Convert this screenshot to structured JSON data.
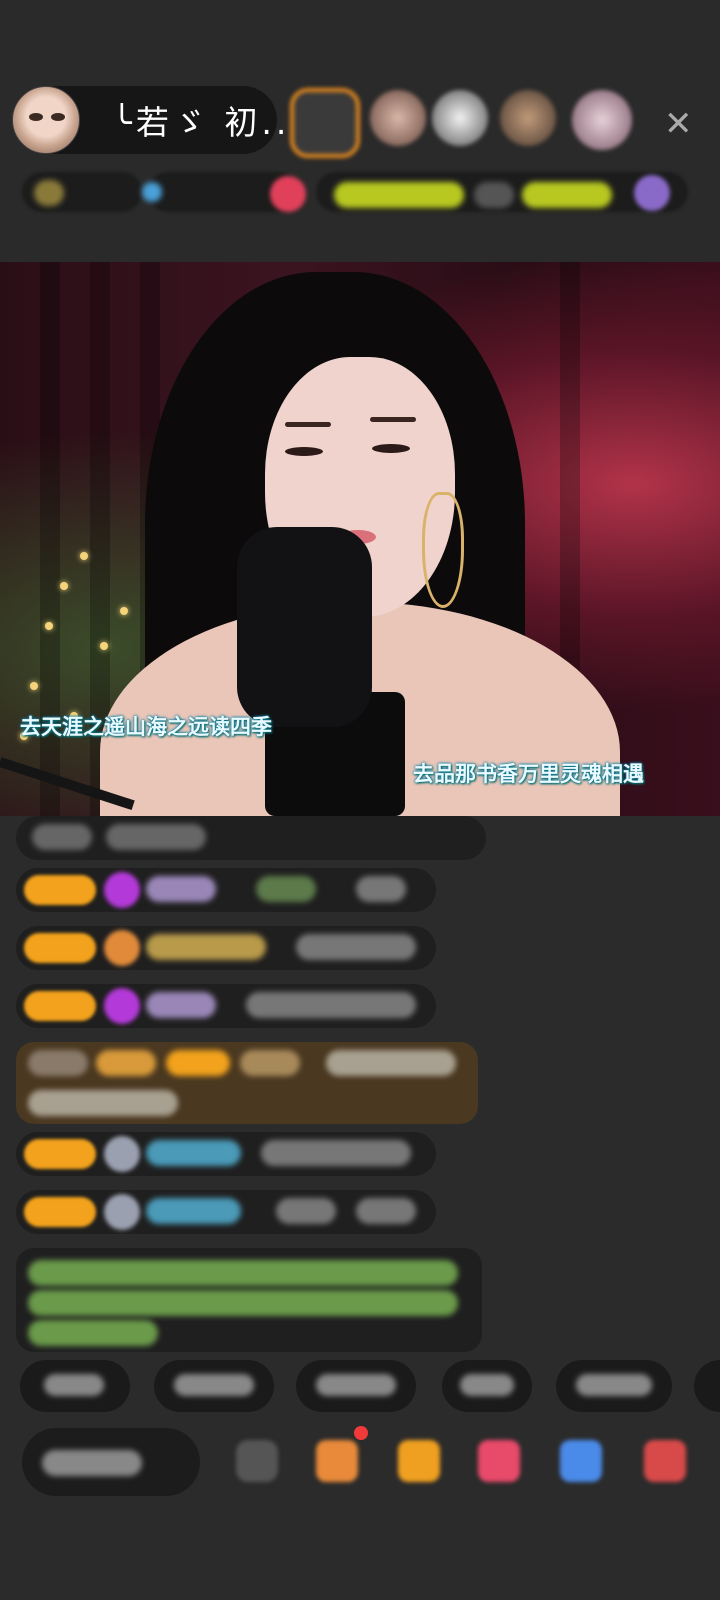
{
  "host": {
    "name": "╰若ゞ 初..."
  },
  "video": {
    "lyric_left": "去天涯之遥山海之远读四季",
    "lyric_right": "去品那书香万里灵魂相遇"
  },
  "icons": {
    "close": "close-icon",
    "more_gift": "gift-icon",
    "emoji": "emoji-icon"
  },
  "colors": {
    "badge": "#f2a21c",
    "background": "#2b2b2b",
    "lyric_glow": "#1aa0d0"
  }
}
